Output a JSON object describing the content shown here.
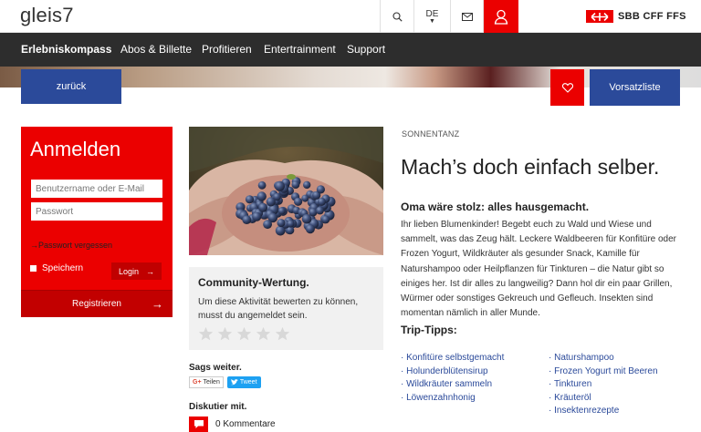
{
  "header": {
    "logo": "gleis7",
    "lang": "DE",
    "sbb_text": "SBB CFF FFS"
  },
  "nav": {
    "items": [
      "Erlebniskompass",
      "Abos & Billette",
      "Profitieren",
      "Entertrainment",
      "Support"
    ]
  },
  "actions": {
    "back": "zurück",
    "wishlist": "Vorsatzliste"
  },
  "login": {
    "title": "Anmelden",
    "username_placeholder": "Benutzername oder E-Mail",
    "password_placeholder": "Passwort",
    "forgot": "Passwort vergessen",
    "remember": "Speichern",
    "login_button": "Login",
    "register": "Registrieren"
  },
  "community": {
    "title": "Community-Wertung.",
    "text": "Um diese Aktivität bewerten zu können, musst du angemeldet sein.",
    "rating": 0,
    "max_rating": 5
  },
  "share": {
    "heading": "Sags weiter.",
    "google": "Teilen",
    "tweet": "Tweet"
  },
  "discuss": {
    "heading": "Diskutier mit.",
    "count": "0 Kommentare"
  },
  "article": {
    "kicker": "SONNENTANZ",
    "headline": "Mach’s doch einfach selber.",
    "subhead": "Oma wäre stolz: alles hausgemacht.",
    "body": "Ihr lieben Blumenkinder! Begebt euch zu Wald und Wiese und sammelt, was das Zeug hält. Leckere Waldbeeren für Konfitüre oder Frozen Yogurt, Wildkräuter als gesunder Snack, Kamille für Naturshampoo oder Heilpflanzen für Tinkturen – die Natur gibt so einiges her. Ist dir alles zu langweilig? Dann hol dir ein paar Grillen, Würmer oder sonstiges Gekreuch und Gefleuch. Insekten sind momentan nämlich in aller Munde.",
    "tips_heading": "Trip-Tipps:",
    "tips_left": [
      "Konfitüre selbstgemacht",
      "Holunderblütensirup",
      "Wildkräuter sammeln",
      "Löwenzahnhonig"
    ],
    "tips_right": [
      "Naturshampoo",
      "Frozen Yogurt mit Beeren",
      "Tinkturen",
      "Kräuteröl",
      "Insektenrezepte"
    ]
  },
  "colors": {
    "red": "#eb0000",
    "blue": "#2b4a9a",
    "nav_bg": "#2d2d2d"
  }
}
